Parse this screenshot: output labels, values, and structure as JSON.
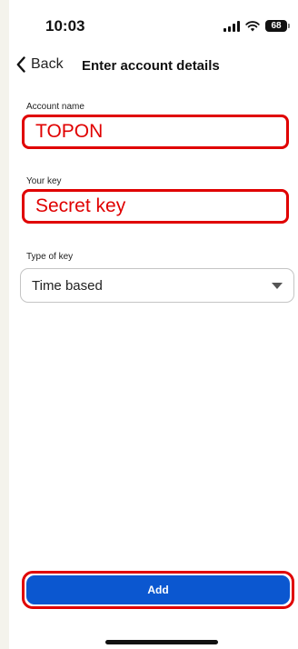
{
  "status_bar": {
    "time": "10:03",
    "battery": "68"
  },
  "nav": {
    "back_label": "Back",
    "title": "Enter account details"
  },
  "form": {
    "account_name": {
      "label": "Account name",
      "value": "TOPON"
    },
    "key": {
      "label": "Your key",
      "value": "Secret key"
    },
    "key_type": {
      "label": "Type of key",
      "selected": "Time based"
    }
  },
  "actions": {
    "add_label": "Add"
  },
  "colors": {
    "highlight": "#e00000",
    "primary": "#0b57d0"
  }
}
